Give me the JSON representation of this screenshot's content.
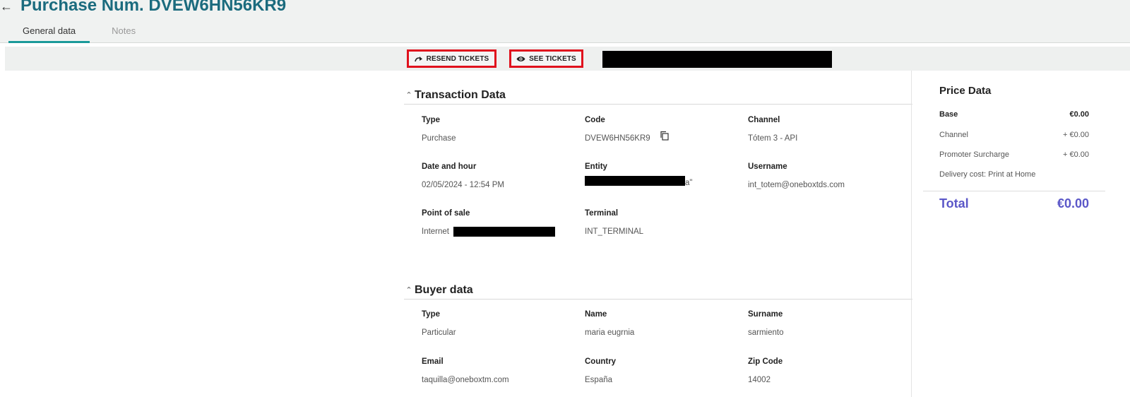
{
  "header": {
    "back_icon": "arrow-left-icon",
    "title": "Purchase Num. DVEW6HN56KR9",
    "tabs": [
      {
        "label": "General data",
        "active": true
      },
      {
        "label": "Notes",
        "active": false
      }
    ]
  },
  "toolbar": {
    "resend_label": "RESEND TICKETS",
    "resend_icon": "forward-arrow-icon",
    "see_label": "SEE TICKETS",
    "see_icon": "eye-icon",
    "highlight_color": "#e0111d"
  },
  "transaction": {
    "title": "Transaction Data",
    "type_label": "Type",
    "type_value": "Purchase",
    "code_label": "Code",
    "code_value": "DVEW6HN56KR9",
    "channel_label": "Channel",
    "channel_value": "Tótem 3 - API",
    "date_label": "Date and hour",
    "date_value": "02/05/2024 - 12:54 PM",
    "entity_label": "Entity",
    "entity_suffix": "a\"",
    "username_label": "Username",
    "username_value": "int_totem@oneboxtds.com",
    "pos_label": "Point of sale",
    "pos_value": "Internet",
    "terminal_label": "Terminal",
    "terminal_value": "INT_TERMINAL"
  },
  "buyer": {
    "title": "Buyer data",
    "type_label": "Type",
    "type_value": "Particular",
    "name_label": "Name",
    "name_value": "maria eugrnia",
    "surname_label": "Surname",
    "surname_value": "sarmiento",
    "email_label": "Email",
    "email_value": "taquilla@oneboxtm.com",
    "country_label": "Country",
    "country_value": "España",
    "zip_label": "Zip Code",
    "zip_value": "14002"
  },
  "price": {
    "title": "Price Data",
    "base_label": "Base",
    "base_value": "€0.00",
    "channel_label": "Channel",
    "channel_value": "+ €0.00",
    "promoter_label": "Promoter Surcharge",
    "promoter_value": "+ €0.00",
    "delivery_label": "Delivery cost: Print at Home",
    "total_label": "Total",
    "total_value": "€0.00",
    "accent_color": "#5b57c8"
  }
}
